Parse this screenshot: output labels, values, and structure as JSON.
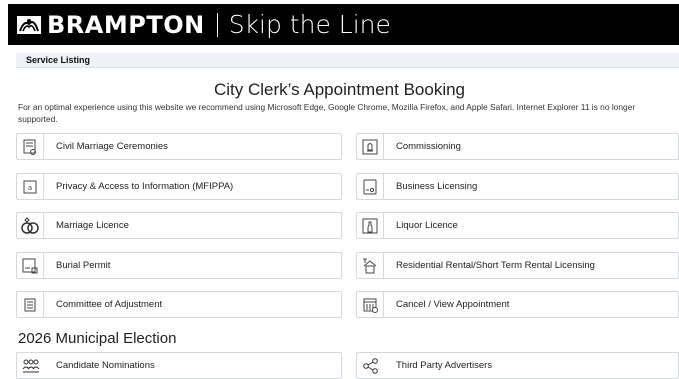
{
  "header": {
    "brand": "BRAMPTON",
    "tagline": "Skip the Line",
    "logo_icon": "brampton-flower-logo"
  },
  "breadcrumb": {
    "label": "Service Listing"
  },
  "page": {
    "title": "City Clerk’s Appointment Booking",
    "notice": "For an optimal experience using this website we recommend using Microsoft Edge, Google Chrome, Mozilla Firefox, and Apple Safari. Internet Explorer 11 is no longer supported."
  },
  "services": [
    {
      "label": "Civil Marriage Ceremonies",
      "icon": "certificate-icon"
    },
    {
      "label": "Commissioning",
      "icon": "stamp-icon"
    },
    {
      "label": "Privacy & Access to Information (MFIPPA)",
      "icon": "privacy-document-icon"
    },
    {
      "label": "Business Licensing",
      "icon": "license-icon"
    },
    {
      "label": "Marriage Licence",
      "icon": "rings-icon"
    },
    {
      "label": "Liquor Licence",
      "icon": "liquor-bottle-icon"
    },
    {
      "label": "Burial Permit",
      "icon": "burial-permit-icon"
    },
    {
      "label": "Residential Rental/Short Term Rental Licensing",
      "icon": "house-rental-icon"
    },
    {
      "label": "Committee of Adjustment",
      "icon": "document-lines-icon"
    },
    {
      "label": "Cancel / View Appointment",
      "icon": "calendar-icon"
    }
  ],
  "election": {
    "title": "2026 Municipal Election",
    "items": [
      {
        "label": "Candidate Nominations",
        "icon": "people-group-icon"
      },
      {
        "label": "Third Party Advertisers",
        "icon": "share-network-icon"
      }
    ]
  }
}
